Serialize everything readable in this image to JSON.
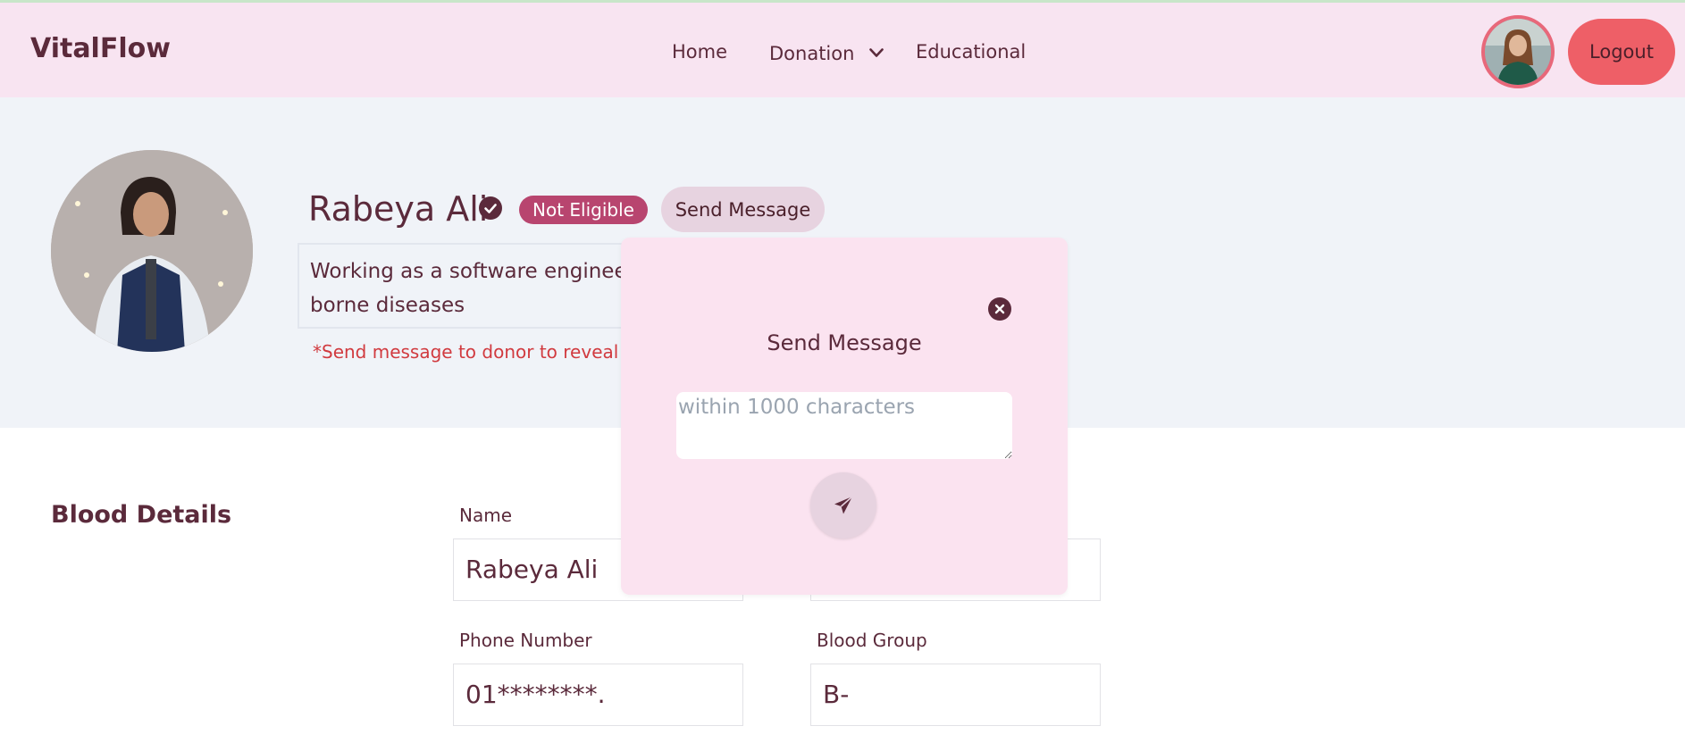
{
  "brand": "VitalFlow",
  "nav": {
    "home": "Home",
    "donation": "Donation",
    "educational": "Educational",
    "logout": "Logout"
  },
  "profile": {
    "name": "Rabeya Ali",
    "status_badge": "Not Eligible",
    "send_message_label": "Send Message",
    "bio": "Working as a software engineer. Have no blood borne diseases",
    "reveal_note": "*Send message to donor to reveal contact information"
  },
  "blood_details": {
    "section_title": "Blood Details",
    "name_label": "Name",
    "name_value": "Rabeya Ali",
    "email_value": "",
    "phone_label": "Phone Number",
    "phone_value": "01********.",
    "blood_group_label": "Blood Group",
    "blood_group_value": "B-"
  },
  "modal": {
    "title": "Send Message",
    "placeholder": "within 1000 characters",
    "message_value": ""
  },
  "icons": {
    "verified": "check-circle-icon",
    "close": "close-circle-icon",
    "send": "paper-plane-icon",
    "chevron": "chevron-down-icon"
  },
  "colors": {
    "navbar_bg": "#f8e4f1",
    "brand_text": "#5b2a3b",
    "logout_bg": "#ee5f67",
    "badge_bg": "#b8456f",
    "modal_bg": "#fbe3f0",
    "hero_bg": "#f0f3f8",
    "warning_text": "#d13a3f"
  }
}
